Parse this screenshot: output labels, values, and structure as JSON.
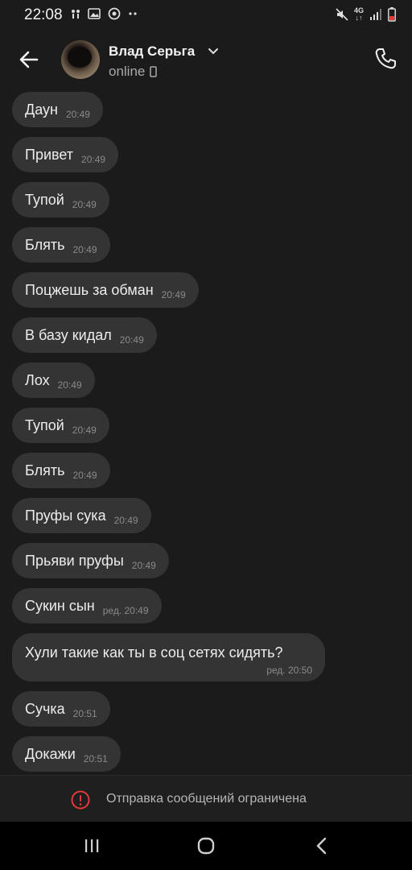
{
  "status_bar": {
    "time": "22:08",
    "network": "4G",
    "icons": [
      "signal-icon",
      "gallery-icon",
      "app-icon",
      "more-dots-icon",
      "mute-icon",
      "network-4g-icon",
      "cell-signal-icon",
      "battery-icon"
    ]
  },
  "header": {
    "contact_name": "Влад Серьга",
    "status": "online",
    "icons": [
      "back-arrow-icon",
      "chevron-down-icon",
      "phone-device-icon",
      "phone-call-icon"
    ]
  },
  "messages": [
    {
      "text": "Даун",
      "time": "20:49"
    },
    {
      "text": "Привет",
      "time": "20:49"
    },
    {
      "text": "Тупой",
      "time": "20:49"
    },
    {
      "text": "Блять",
      "time": "20:49"
    },
    {
      "text": "Поцжешь за обман",
      "time": "20:49"
    },
    {
      "text": "В базу кидал",
      "time": "20:49"
    },
    {
      "text": "Лох",
      "time": "20:49"
    },
    {
      "text": "Тупой",
      "time": "20:49"
    },
    {
      "text": "Блять",
      "time": "20:49"
    },
    {
      "text": "Пруфы сука",
      "time": "20:49"
    },
    {
      "text": "Прьяви пруфы",
      "time": "20:49"
    },
    {
      "text": "Сукин сын",
      "time": "ред. 20:49"
    },
    {
      "text": "Хули такие как ты в соц сетях сидять?",
      "time": "ред. 20:50"
    },
    {
      "text": "Сучка",
      "time": "20:51"
    },
    {
      "text": "Докажи",
      "time": "20:51"
    }
  ],
  "restricted_bar": {
    "text": "Отправка сообщений ограничена",
    "accent_color": "#e53935"
  },
  "nav_bar": {
    "buttons": [
      "recent-apps-icon",
      "home-icon",
      "back-icon"
    ]
  }
}
